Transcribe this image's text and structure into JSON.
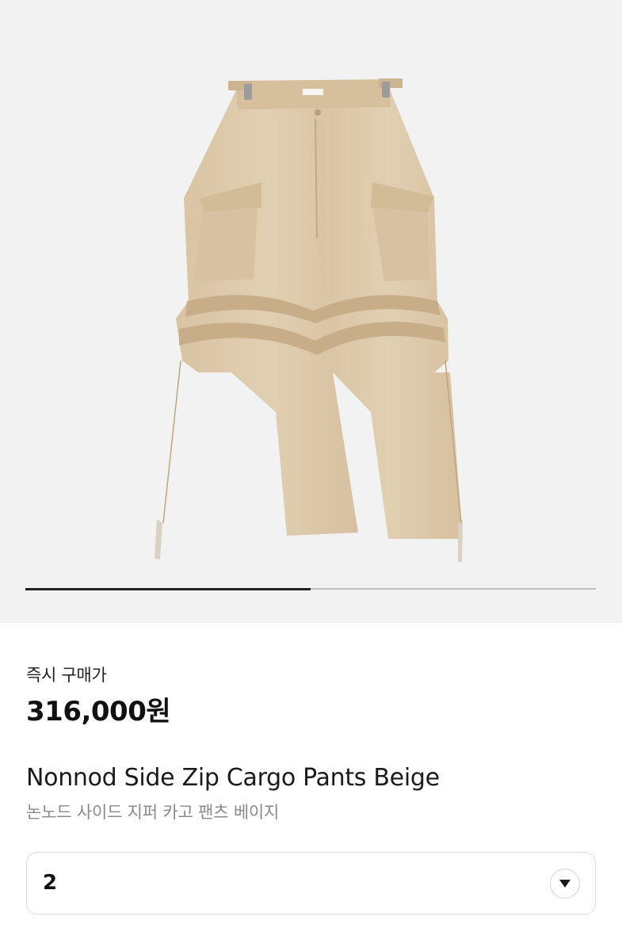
{
  "gallery": {
    "image_alt_icon": "pants-product-image",
    "progress_fraction": 0.5
  },
  "price_section": {
    "label": "즉시 구매가",
    "price": "316,000원"
  },
  "product": {
    "name_en": "Nonnod Side Zip Cargo Pants Beige",
    "name_ko": "논노드 사이드 지퍼 카고 팬츠 베이지"
  },
  "size_selector": {
    "selected_value": "2",
    "icon": "chevron-down-icon"
  },
  "colors": {
    "fabric": "#ddc9aa",
    "hero_bg": "#f2f2f2",
    "progress_fill": "#222222",
    "progress_track": "#bfbfbf"
  }
}
